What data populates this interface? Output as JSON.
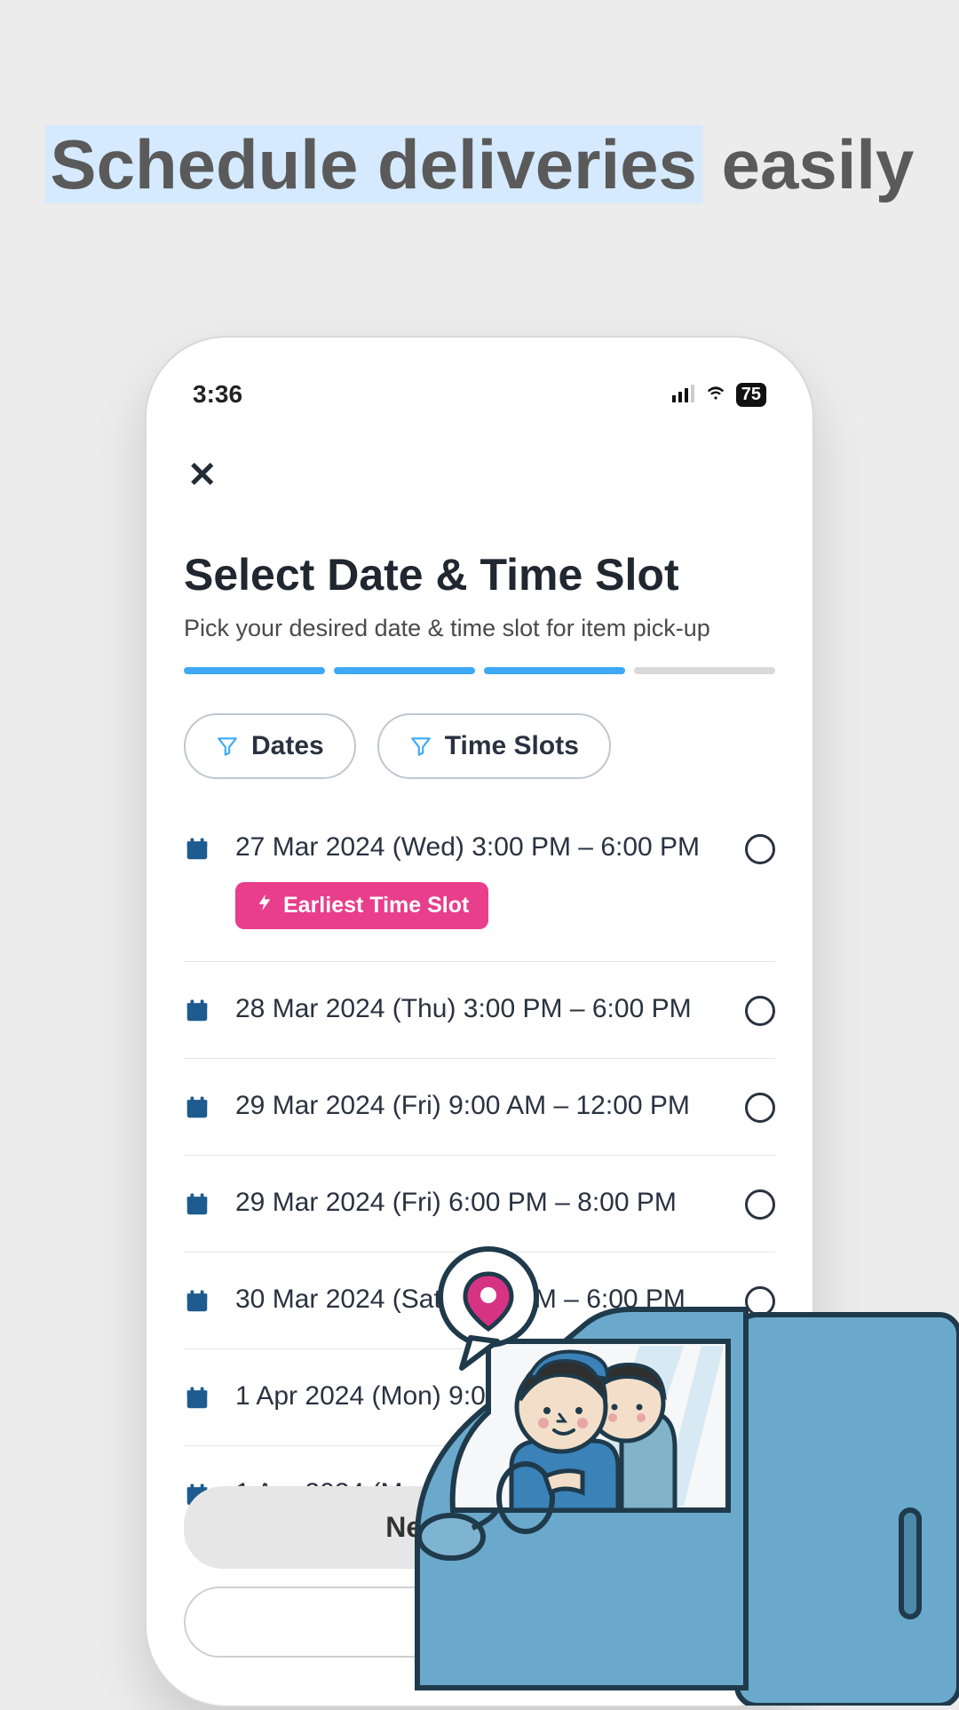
{
  "headline": {
    "part1": "Schedule deliveries",
    "part2": "easily"
  },
  "status": {
    "time": "3:36",
    "battery": "75"
  },
  "close_label": "✕",
  "page": {
    "title": "Select Date & Time Slot",
    "subtitle": "Pick your desired date & time slot for item pick-up"
  },
  "progress": {
    "completed": 3,
    "total": 4
  },
  "filters": {
    "dates_label": "Dates",
    "timeslots_label": "Time Slots"
  },
  "earliest_badge": "Earliest Time Slot",
  "slots": [
    {
      "text": "27 Mar 2024 (Wed) 3:00 PM – 6:00 PM",
      "earliest": true
    },
    {
      "text": "28 Mar 2024 (Thu) 3:00 PM – 6:00 PM",
      "earliest": false
    },
    {
      "text": "29 Mar 2024 (Fri) 9:00 AM – 12:00 PM",
      "earliest": false
    },
    {
      "text": "29 Mar 2024 (Fri) 6:00 PM – 8:00 PM",
      "earliest": false
    },
    {
      "text": "30 Mar 2024 (Sat) 3:00 PM – 6:00 PM",
      "earliest": false
    },
    {
      "text": "1 Apr 2024 (Mon) 9:00",
      "earliest": false
    },
    {
      "text": "1 Apr 2024 (Mon)",
      "earliest": false
    }
  ],
  "next_button": "Next: Confirm",
  "colors": {
    "accent_filter": "#3fa9f5",
    "brand_pink": "#e83e8c",
    "cal_icon": "#1e5b8e"
  }
}
